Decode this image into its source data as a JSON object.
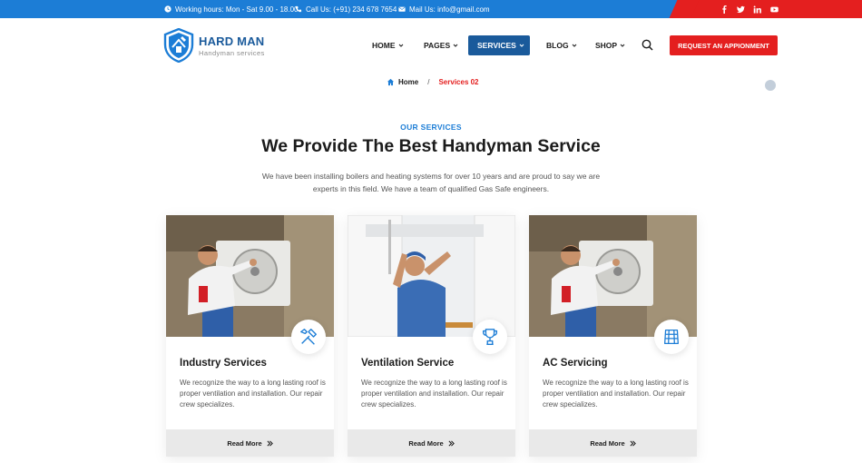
{
  "topbar": {
    "hours": "Working hours: Mon - Sat 9.00 - 18.00",
    "phone": "Call Us: (+91) 234 678 7654",
    "mail": "Mail Us: info@gmail.com",
    "socials": [
      "facebook-icon",
      "twitter-icon",
      "linkedin-icon",
      "youtube-icon"
    ]
  },
  "brand": {
    "name": "HARD MAN",
    "tagline": "Handyman services"
  },
  "nav": {
    "items": [
      {
        "label": "HOME",
        "has_dropdown": true
      },
      {
        "label": "PAGES",
        "has_dropdown": true
      },
      {
        "label": "SERVICES",
        "has_dropdown": true,
        "active": true
      },
      {
        "label": "BLOG",
        "has_dropdown": true
      },
      {
        "label": "SHOP",
        "has_dropdown": true
      }
    ],
    "cta_label": "REQUEST AN APPIONMENT"
  },
  "breadcrumb": {
    "home": "Home",
    "separator": "/",
    "current": "Services 02"
  },
  "section": {
    "eyebrow": "OUR SERVICES",
    "headline": "We Provide The Best Handyman Service",
    "intro": "We have been installing boilers and heating systems for over 10 years and are proud to say we are experts in this field. We have a team of qualified Gas Safe engineers."
  },
  "cards": [
    {
      "title": "Industry Services",
      "text": "We recognize the way to a long lasting roof is proper ventilation and installation. Our repair crew specializes.",
      "link": "Read More",
      "icon": "tools-icon"
    },
    {
      "title": "Ventilation Service",
      "text": "We recognize the way to a long lasting roof is proper ventilation and installation. Our repair crew specializes.",
      "link": "Read More",
      "icon": "trophy-icon"
    },
    {
      "title": "AC Servicing",
      "text": "We recognize the way to a long lasting roof is proper ventilation and installation. Our repair crew specializes.",
      "link": "Read More",
      "icon": "roof-tiles-icon"
    }
  ],
  "colors": {
    "primary_blue": "#1c7dd6",
    "navy": "#1a5a9b",
    "accent_red": "#e41f1f"
  }
}
